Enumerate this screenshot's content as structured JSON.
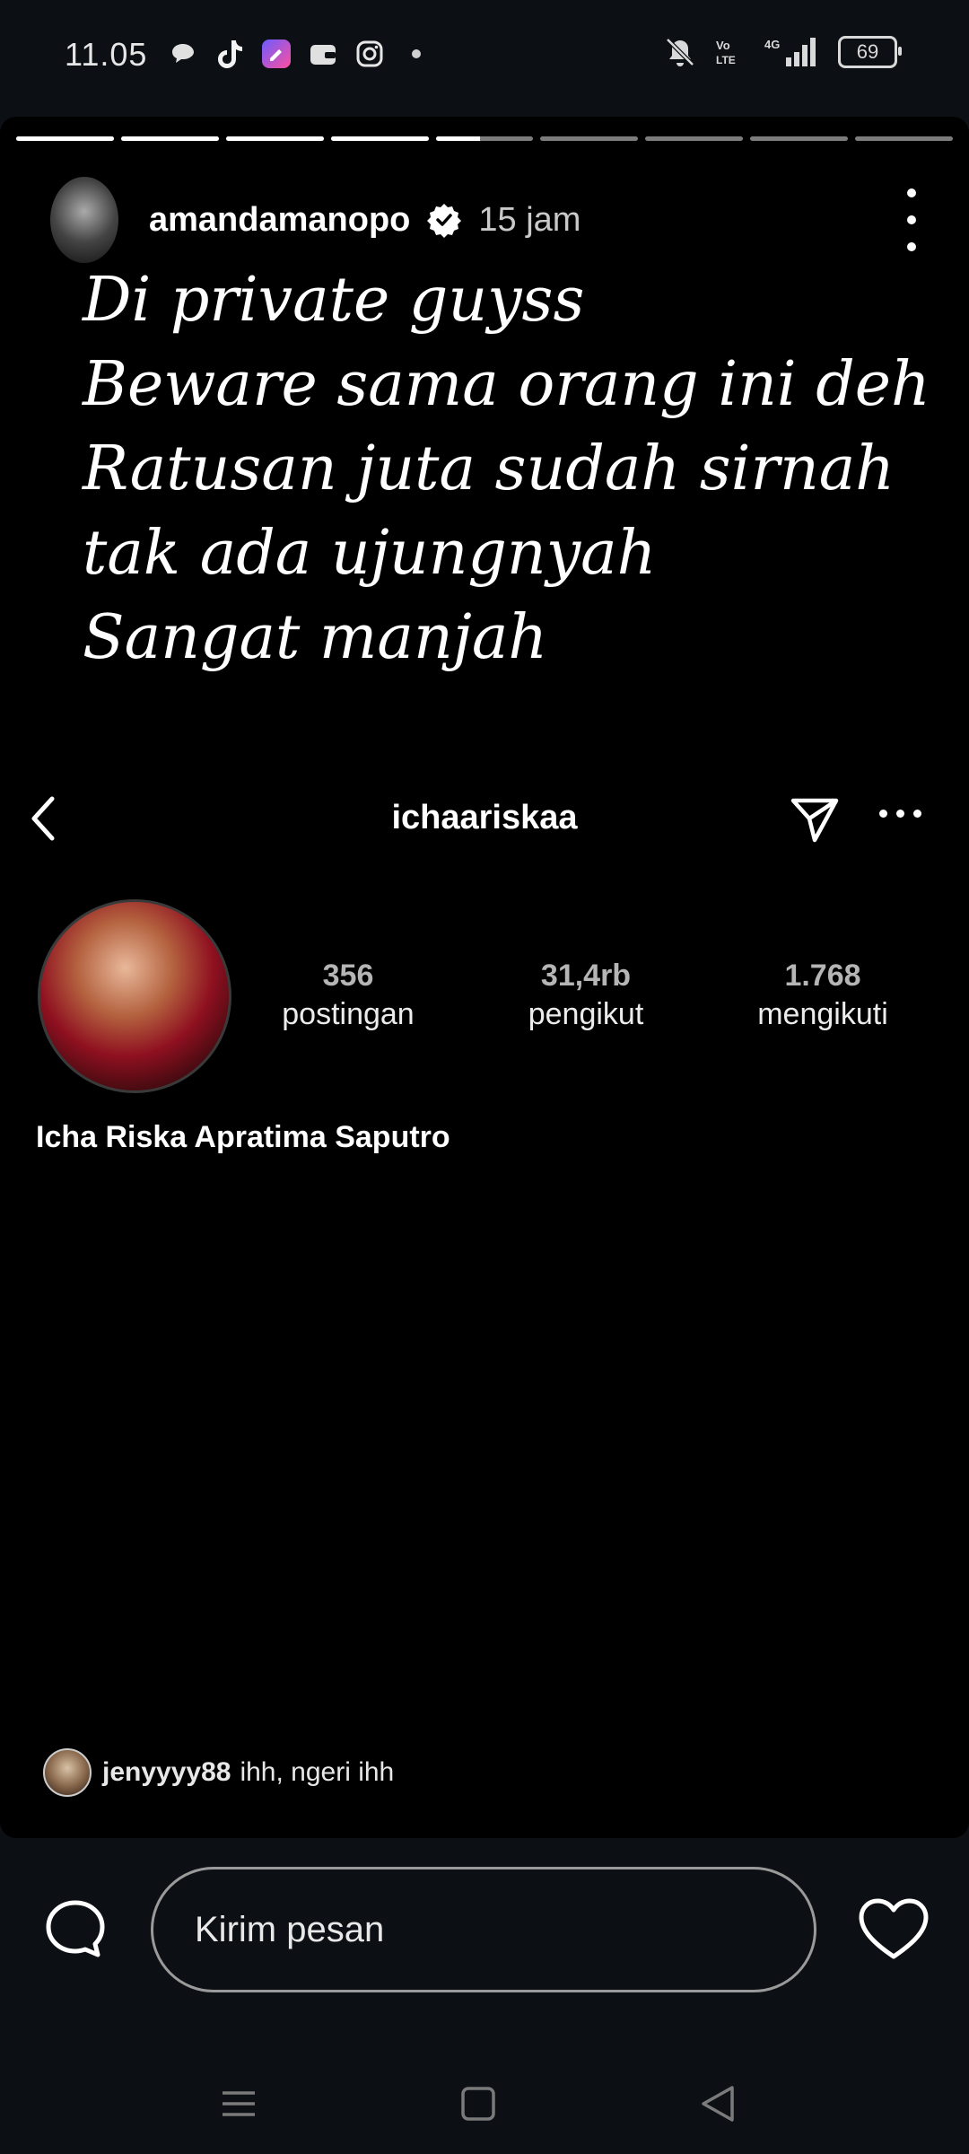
{
  "status_bar": {
    "time": "11.05",
    "battery": "69"
  },
  "story": {
    "progress": [
      1,
      1,
      1,
      1,
      0.45,
      0,
      0,
      0,
      0
    ],
    "username": "amandamanopo",
    "time_ago": "15 jam",
    "caption_lines": [
      "Di private guyss",
      "Beware sama orang ini deh",
      "Ratusan juta sudah sirnah",
      "tak ada ujungnyah",
      "Sangat manjah"
    ]
  },
  "profile": {
    "username": "ichaariskaa",
    "stats": [
      {
        "num": "356",
        "label": "postingan"
      },
      {
        "num": "31,4rb",
        "label": "pengikut"
      },
      {
        "num": "1.768",
        "label": "mengikuti"
      }
    ],
    "full_name": "Icha Riska Apratima Saputro"
  },
  "reply": {
    "username": "jenyyyy88",
    "text": "ihh, ngeri ihh"
  },
  "message": {
    "placeholder": "Kirim pesan"
  },
  "colors": {
    "background": "#0c0f14",
    "story_background": "#000000"
  }
}
